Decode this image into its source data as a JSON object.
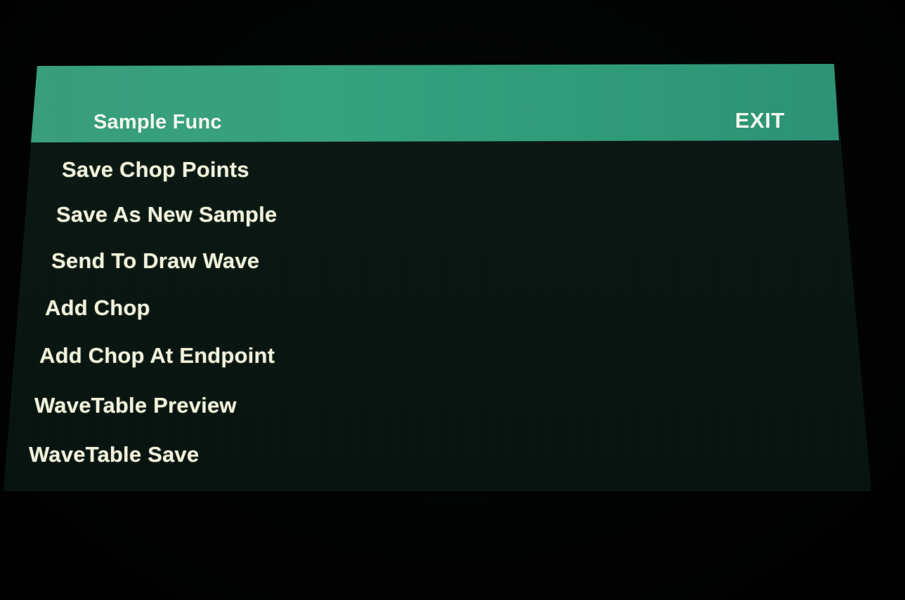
{
  "header": {
    "title": "Sample Func",
    "exit_label": "EXIT"
  },
  "menu": {
    "items": [
      {
        "label": "Save Chop Points"
      },
      {
        "label": "Save As New Sample"
      },
      {
        "label": "Send To Draw Wave"
      },
      {
        "label": "Add Chop"
      },
      {
        "label": "Add Chop At Endpoint"
      },
      {
        "label": "WaveTable Preview"
      },
      {
        "label": "WaveTable Save"
      }
    ]
  },
  "colors": {
    "header_accent": "#36a27e",
    "screen_background": "#0a1713",
    "text": "#f1f2dc"
  }
}
